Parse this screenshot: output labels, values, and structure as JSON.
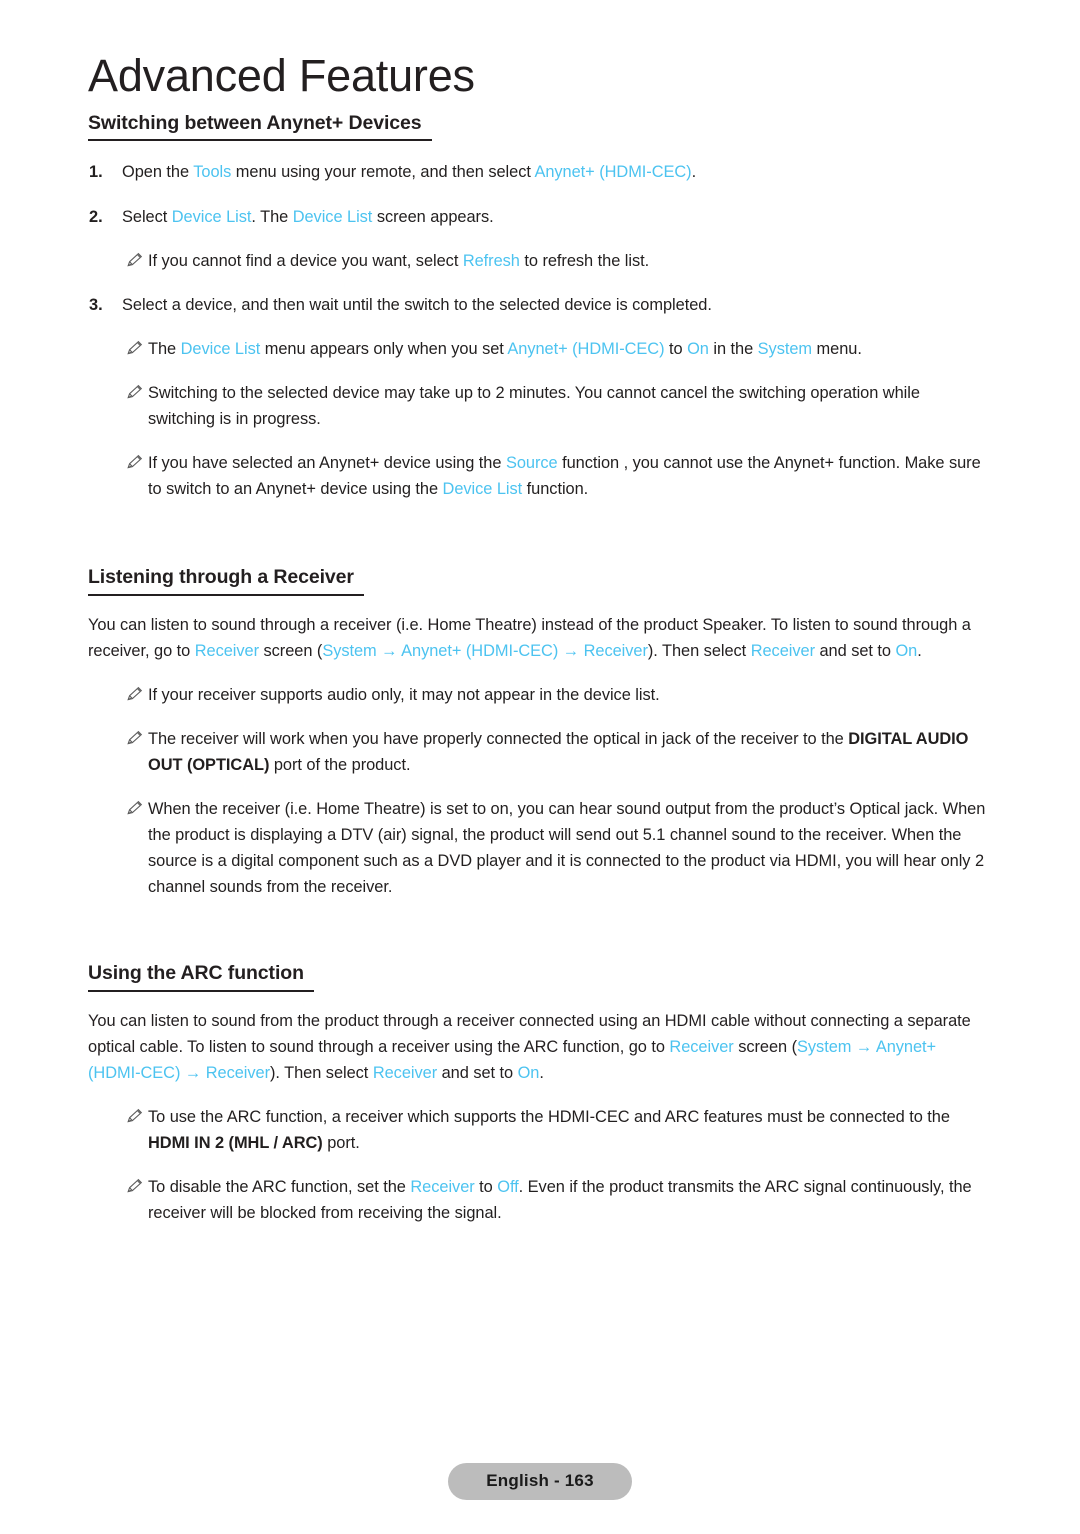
{
  "page": {
    "title": "Advanced Features",
    "footer_label": "English - 163",
    "accent_color": "#4cc3f0",
    "text_color": "#231f20",
    "footer_bg": "#bcbcbc"
  },
  "icons": {
    "note_icon": "pencil-icon"
  },
  "sections": {
    "anynet": {
      "heading": "Switching between Anynet+ Devices",
      "steps": [
        {
          "number": "1.",
          "parts": [
            {
              "t": "Open the ",
              "s": "n"
            },
            {
              "t": "Tools",
              "s": "hl"
            },
            {
              "t": " menu using your remote, and then select ",
              "s": "n"
            },
            {
              "t": "Anynet+ (HDMI-CEC)",
              "s": "hl"
            },
            {
              "t": ".",
              "s": "n"
            }
          ]
        },
        {
          "number": "2.",
          "parts": [
            {
              "t": "Select ",
              "s": "n"
            },
            {
              "t": "Device List",
              "s": "hl"
            },
            {
              "t": ". The ",
              "s": "n"
            },
            {
              "t": "Device List",
              "s": "hl"
            },
            {
              "t": " screen appears.",
              "s": "n"
            }
          ]
        },
        {
          "number": "3.",
          "parts": [
            {
              "t": "Select a device, and then wait until the switch to the selected device is completed.",
              "s": "n"
            }
          ]
        }
      ],
      "note_after_step2": {
        "parts": [
          {
            "t": "If you cannot find a device you want, select ",
            "s": "n"
          },
          {
            "t": "Refresh",
            "s": "hl"
          },
          {
            "t": " to refresh the list.",
            "s": "n"
          }
        ]
      },
      "notes": [
        {
          "parts": [
            {
              "t": "The ",
              "s": "n"
            },
            {
              "t": "Device List",
              "s": "hl"
            },
            {
              "t": " menu appears only when you set ",
              "s": "n"
            },
            {
              "t": "Anynet+ (HDMI-CEC)",
              "s": "hl"
            },
            {
              "t": " to ",
              "s": "n"
            },
            {
              "t": "On",
              "s": "hl"
            },
            {
              "t": " in the ",
              "s": "n"
            },
            {
              "t": "System",
              "s": "hl"
            },
            {
              "t": " menu.",
              "s": "n"
            }
          ]
        },
        {
          "parts": [
            {
              "t": "Switching to the selected device may take up to 2 minutes. You cannot cancel the switching operation while switching is in progress.",
              "s": "n"
            }
          ]
        },
        {
          "parts": [
            {
              "t": "If you have selected an Anynet+ device using the ",
              "s": "n"
            },
            {
              "t": "Source",
              "s": "hl"
            },
            {
              "t": " function , you cannot use the Anynet+ function. Make sure to switch to an Anynet+ device using the ",
              "s": "n"
            },
            {
              "t": "Device List",
              "s": "hl"
            },
            {
              "t": " function.",
              "s": "n"
            }
          ]
        }
      ]
    },
    "receiver": {
      "heading": "Listening through a Receiver",
      "paragraph": {
        "parts": [
          {
            "t": "You can listen to sound through a receiver (i.e. Home Theatre) instead of the product Speaker. To listen to sound through a receiver, go to ",
            "s": "n"
          },
          {
            "t": "Receiver",
            "s": "hl"
          },
          {
            "t": " screen (",
            "s": "n"
          },
          {
            "t": "System",
            "s": "hl"
          },
          {
            "t": " → ",
            "s": "hl"
          },
          {
            "t": "Anynet+ (HDMI-CEC)",
            "s": "hl"
          },
          {
            "t": " → ",
            "s": "hl"
          },
          {
            "t": "Receiver",
            "s": "hl"
          },
          {
            "t": "). Then select ",
            "s": "n"
          },
          {
            "t": "Receiver",
            "s": "hl"
          },
          {
            "t": " and set to ",
            "s": "n"
          },
          {
            "t": "On",
            "s": "hl"
          },
          {
            "t": ".",
            "s": "n"
          }
        ]
      },
      "notes": [
        {
          "parts": [
            {
              "t": "If your receiver supports audio only, it may not appear in the device list.",
              "s": "n"
            }
          ]
        },
        {
          "parts": [
            {
              "t": "The receiver will work when you have properly connected the optical in jack of the receiver to the ",
              "s": "n"
            },
            {
              "t": "DIGITAL AUDIO OUT (OPTICAL)",
              "s": "b"
            },
            {
              "t": " port of the product.",
              "s": "n"
            }
          ]
        },
        {
          "parts": [
            {
              "t": "When the receiver (i.e. Home Theatre) is set to on, you can hear sound output from the product’s Optical jack. When the product is displaying a DTV (air) signal, the product will send out 5.1 channel sound to the receiver. When the source is a digital component such as a DVD player and it is connected to the product via HDMI, you will hear only 2 channel sounds from the receiver.",
              "s": "n"
            }
          ]
        }
      ]
    },
    "arc": {
      "heading": "Using the ARC function",
      "paragraph": {
        "parts": [
          {
            "t": "You can listen to sound from the product through a receiver connected using an HDMI cable without connecting a separate optical cable. To listen to sound through a receiver using the ARC function, go to ",
            "s": "n"
          },
          {
            "t": "Receiver",
            "s": "hl"
          },
          {
            "t": " screen (",
            "s": "n"
          },
          {
            "t": "System",
            "s": "hl"
          },
          {
            "t": " → ",
            "s": "hl"
          },
          {
            "t": "Anynet+ (HDMI-CEC)",
            "s": "hl"
          },
          {
            "t": " → ",
            "s": "hl"
          },
          {
            "t": "Receiver",
            "s": "hl"
          },
          {
            "t": "). Then select ",
            "s": "n"
          },
          {
            "t": "Receiver",
            "s": "hl"
          },
          {
            "t": " and set to ",
            "s": "n"
          },
          {
            "t": "On",
            "s": "hl"
          },
          {
            "t": ".",
            "s": "n"
          }
        ]
      },
      "notes": [
        {
          "parts": [
            {
              "t": "To use the ARC function, a receiver which supports the HDMI-CEC and ARC features must be connected to the ",
              "s": "n"
            },
            {
              "t": "HDMI IN 2 (MHL / ARC)",
              "s": "b"
            },
            {
              "t": " port.",
              "s": "n"
            }
          ]
        },
        {
          "parts": [
            {
              "t": "To disable the ARC function, set the ",
              "s": "n"
            },
            {
              "t": "Receiver",
              "s": "hl"
            },
            {
              "t": " to ",
              "s": "n"
            },
            {
              "t": "Off",
              "s": "hl"
            },
            {
              "t": ". Even if the product transmits the ARC signal continuously, the receiver will be blocked from receiving the signal.",
              "s": "n"
            }
          ]
        }
      ]
    }
  }
}
